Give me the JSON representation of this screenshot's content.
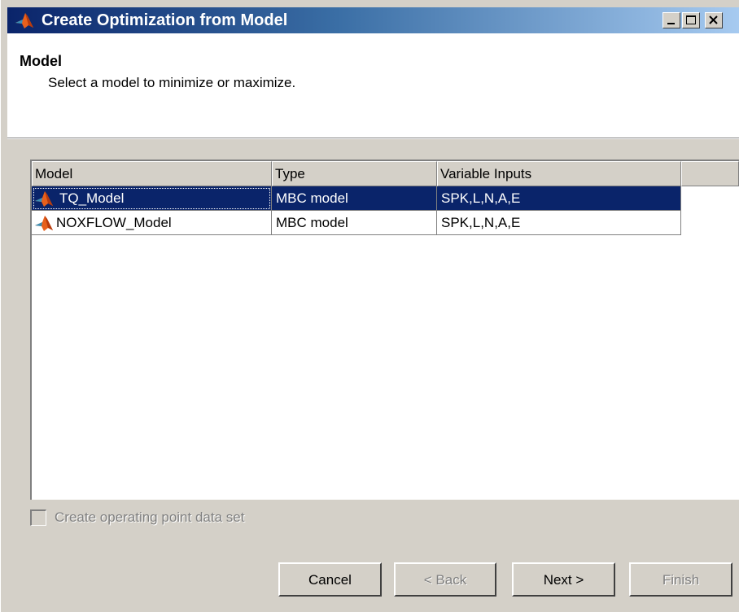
{
  "window": {
    "title": "Create Optimization from Model",
    "icon": "matlab-icon",
    "controls": [
      "minimize-icon",
      "maximize-icon",
      "close-icon"
    ]
  },
  "header": {
    "title": "Model",
    "subtitle": "Select a model to minimize or maximize."
  },
  "table": {
    "columns": [
      "Model",
      "Type",
      "Variable Inputs"
    ],
    "rows": [
      {
        "name": "TQ_Model",
        "type": "MBC model",
        "inputs": "SPK,L,N,A,E",
        "selected": true
      },
      {
        "name": "NOXFLOW_Model",
        "type": "MBC model",
        "inputs": "SPK,L,N,A,E",
        "selected": false
      }
    ]
  },
  "options": {
    "operating_point_label": "Create operating point data set",
    "operating_point_checked": false,
    "operating_point_enabled": false
  },
  "buttons": {
    "cancel": "Cancel",
    "back": "< Back",
    "next": "Next >",
    "finish": "Finish"
  },
  "colors": {
    "title_gradient_start": "#0a246a",
    "selection": "#0a246a",
    "face": "#d4d0c8"
  }
}
